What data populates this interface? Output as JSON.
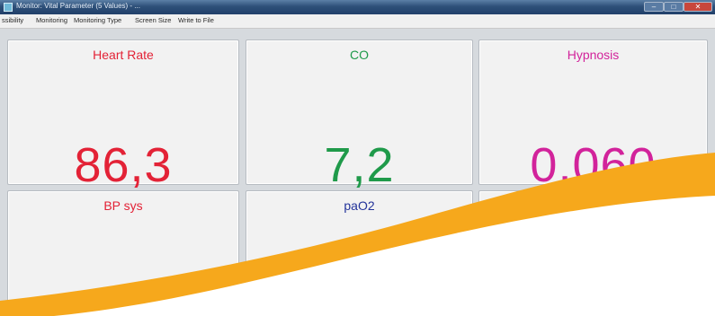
{
  "window": {
    "title": "Monitor: Vital Parameter (5 Values) - ...",
    "controls": {
      "minimize": "–",
      "maximize": "□",
      "close": "✕"
    }
  },
  "menu": {
    "items": [
      "ssibility",
      "Monitoring",
      "Monitoring Type",
      "Screen Size",
      "Write to File"
    ]
  },
  "panels": [
    {
      "title": "Heart Rate",
      "value": "86,3",
      "color": "#e32236"
    },
    {
      "title": "CO",
      "value": "7,2",
      "color": "#1f9a4a"
    },
    {
      "title": "Hypnosis",
      "value": "0,060",
      "color": "#d2239b"
    },
    {
      "title": "BP sys",
      "value": "",
      "color": "#e32236"
    },
    {
      "title": "paO2",
      "value": "",
      "color": "#23339a"
    },
    {
      "title": "",
      "value": "",
      "color": "#333333"
    }
  ],
  "colors": {
    "overlay_orange": "#f6a81c",
    "overlay_white": "#ffffff"
  }
}
